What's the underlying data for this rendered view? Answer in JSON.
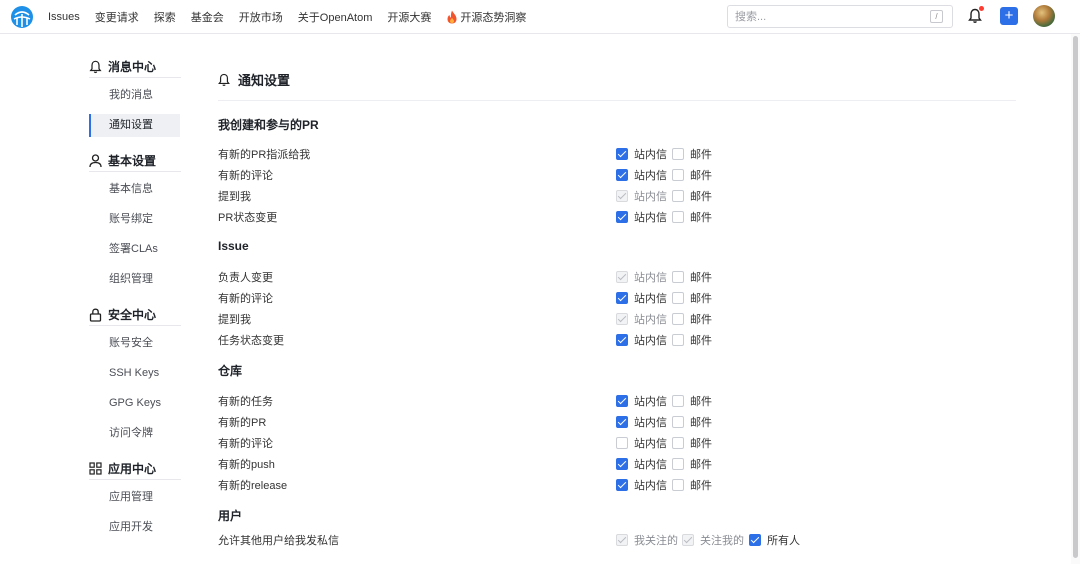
{
  "topbar": {
    "nav": [
      "Issues",
      "变更请求",
      "探索",
      "基金会",
      "开放市场",
      "关于OpenAtom",
      "开源大赛"
    ],
    "hot_link": "开源态势洞察",
    "search_placeholder": "搜索...",
    "search_shortcut": "/",
    "plus_label": "+"
  },
  "sidebar": {
    "groups": [
      {
        "title": "消息中心",
        "icon": "bell-icon",
        "items": [
          "我的消息",
          "通知设置"
        ]
      },
      {
        "title": "基本设置",
        "icon": "user-icon",
        "items": [
          "基本信息",
          "账号绑定",
          "签署CLAs",
          "组织管理"
        ]
      },
      {
        "title": "安全中心",
        "icon": "lock-icon",
        "items": [
          "账号安全",
          "SSH Keys",
          "GPG Keys",
          "访问令牌"
        ]
      },
      {
        "title": "应用中心",
        "icon": "grid-icon",
        "items": [
          "应用管理",
          "应用开发"
        ]
      }
    ],
    "active_item": "通知设置"
  },
  "main": {
    "title": "通知设置",
    "option_site": "站内信",
    "option_mail": "邮件",
    "sections": [
      {
        "title": "我创建和参与的PR",
        "rows": [
          {
            "label": "有新的PR指派给我",
            "site": "checked",
            "mail": "unchecked"
          },
          {
            "label": "有新的评论",
            "site": "checked",
            "mail": "unchecked"
          },
          {
            "label": "提到我",
            "site": "disabled",
            "mail": "unchecked"
          },
          {
            "label": "PR状态变更",
            "site": "checked",
            "mail": "unchecked"
          }
        ]
      },
      {
        "title": "Issue",
        "rows": [
          {
            "label": "负责人变更",
            "site": "disabled",
            "mail": "unchecked"
          },
          {
            "label": "有新的评论",
            "site": "checked",
            "mail": "unchecked"
          },
          {
            "label": "提到我",
            "site": "disabled",
            "mail": "unchecked"
          },
          {
            "label": "任务状态变更",
            "site": "checked",
            "mail": "unchecked"
          }
        ]
      },
      {
        "title": "仓库",
        "rows": [
          {
            "label": "有新的任务",
            "site": "checked",
            "mail": "unchecked"
          },
          {
            "label": "有新的PR",
            "site": "checked",
            "mail": "unchecked"
          },
          {
            "label": "有新的评论",
            "site": "unchecked",
            "mail": "unchecked"
          },
          {
            "label": "有新的push",
            "site": "checked",
            "mail": "unchecked"
          },
          {
            "label": "有新的release",
            "site": "checked",
            "mail": "unchecked"
          }
        ]
      }
    ],
    "users_section": {
      "title": "用户",
      "label": "允许其他用户给我发私信",
      "options": [
        {
          "text": "我关注的",
          "state": "disabled"
        },
        {
          "text": "关注我的",
          "state": "disabled"
        },
        {
          "text": "所有人",
          "state": "checked"
        }
      ]
    }
  },
  "colors": {
    "accent": "#2d6fe6",
    "notification_dot": "#ff3b30",
    "logo": "#1e90e8"
  }
}
